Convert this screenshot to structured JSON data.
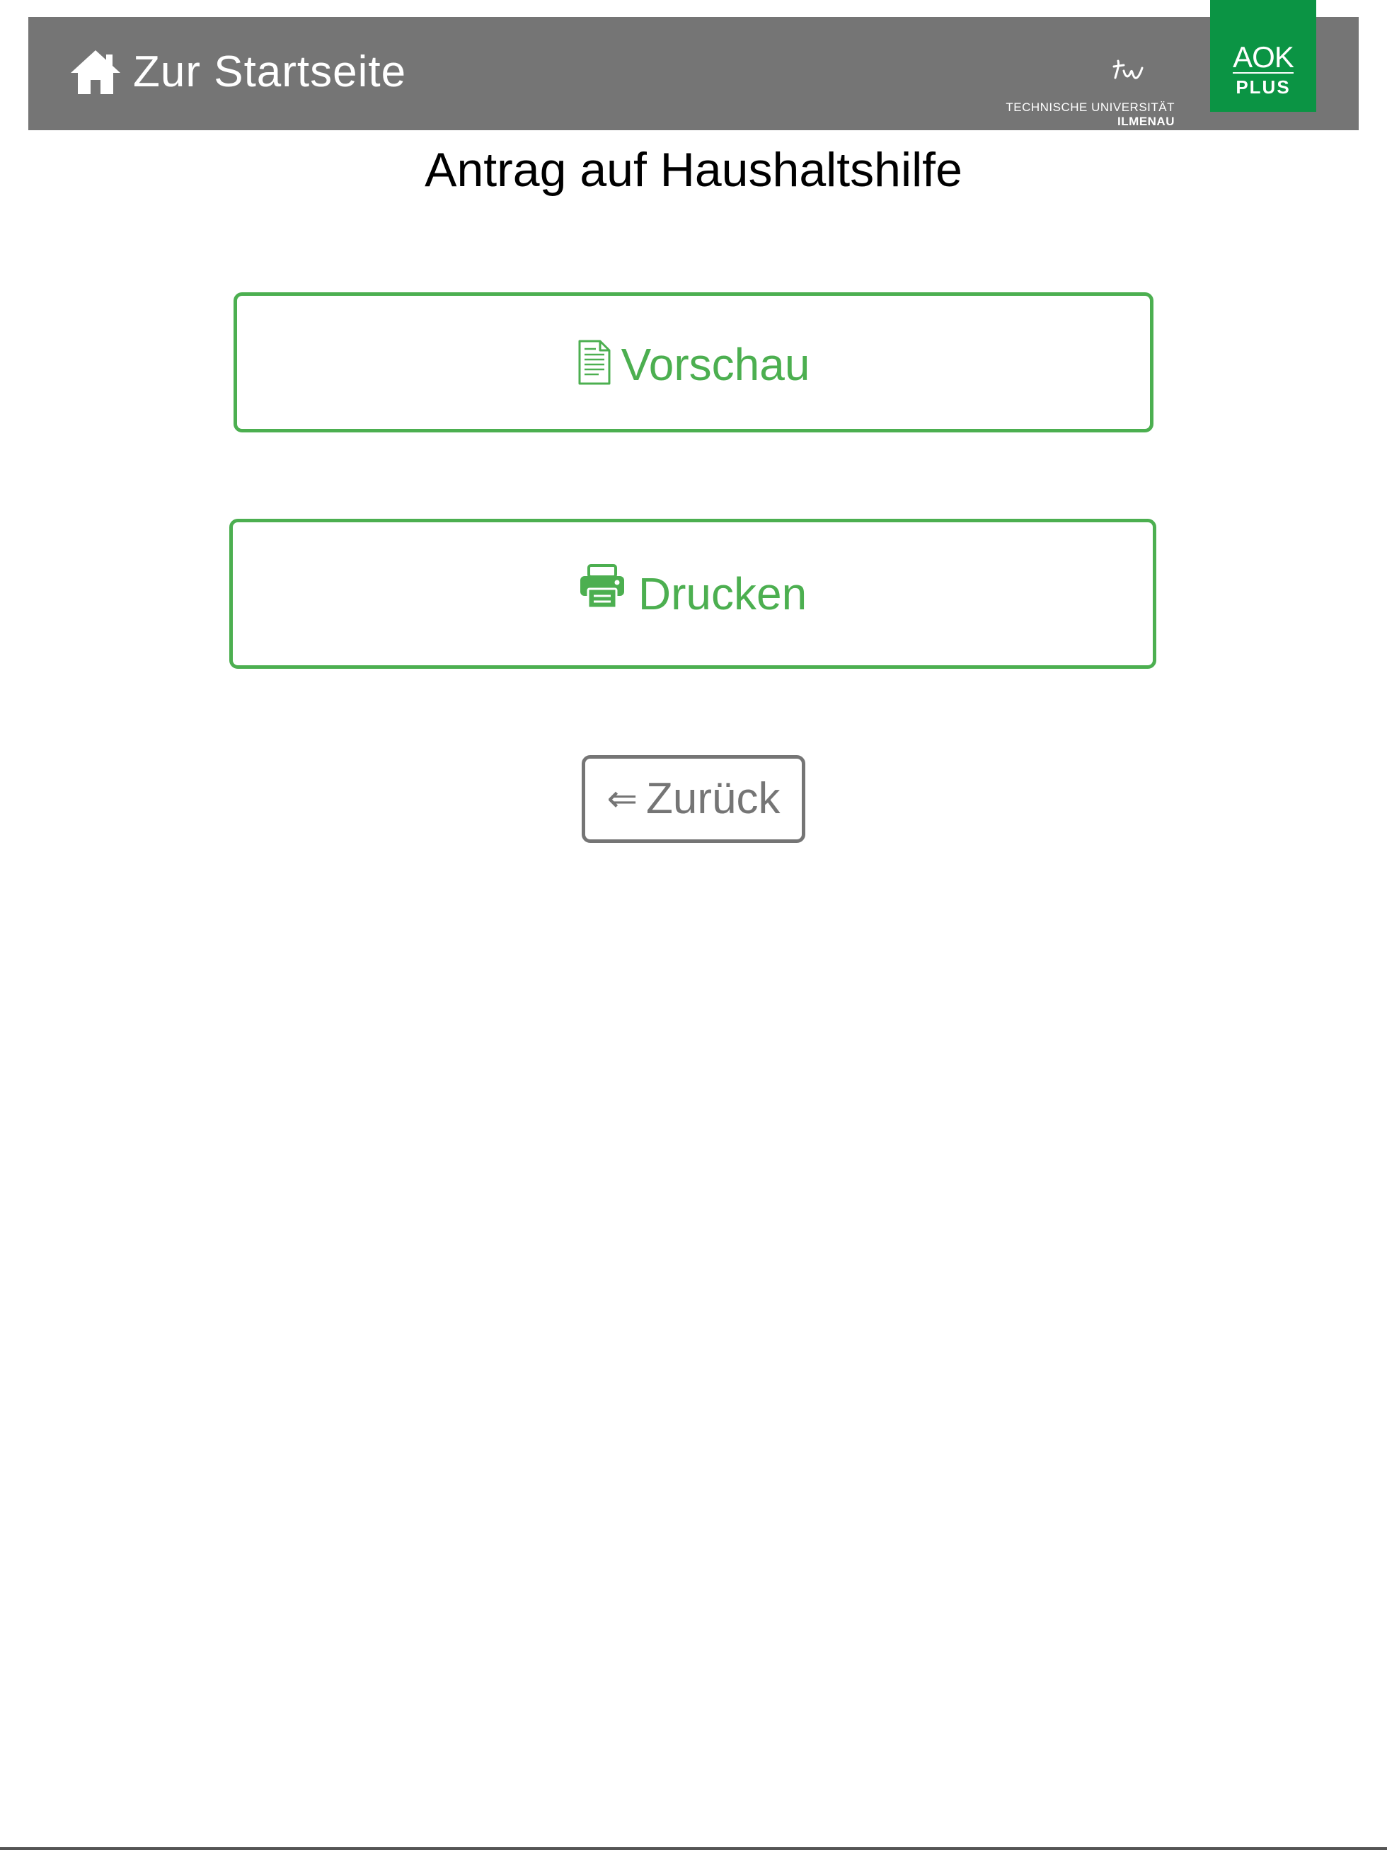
{
  "header": {
    "home_label": "Zur Startseite",
    "tu_logo": {
      "line1": "TECHNISCHE UNIVERSITÄT",
      "line2": "ILMENAU"
    },
    "aok_logo": {
      "word": "AOK",
      "plus": "PLUS",
      "background_color": "#0b9444"
    },
    "background_color": "#757575"
  },
  "main": {
    "title": "Antrag auf Haushaltshilfe",
    "buttons": {
      "preview_label": "Vorschau",
      "preview_icon": "document-icon",
      "print_label": "Drucken",
      "print_icon": "printer-icon",
      "back_arrow": "⇐",
      "back_label": "Zurück"
    },
    "accent_color": "#4caf50",
    "secondary_color": "#757575"
  }
}
